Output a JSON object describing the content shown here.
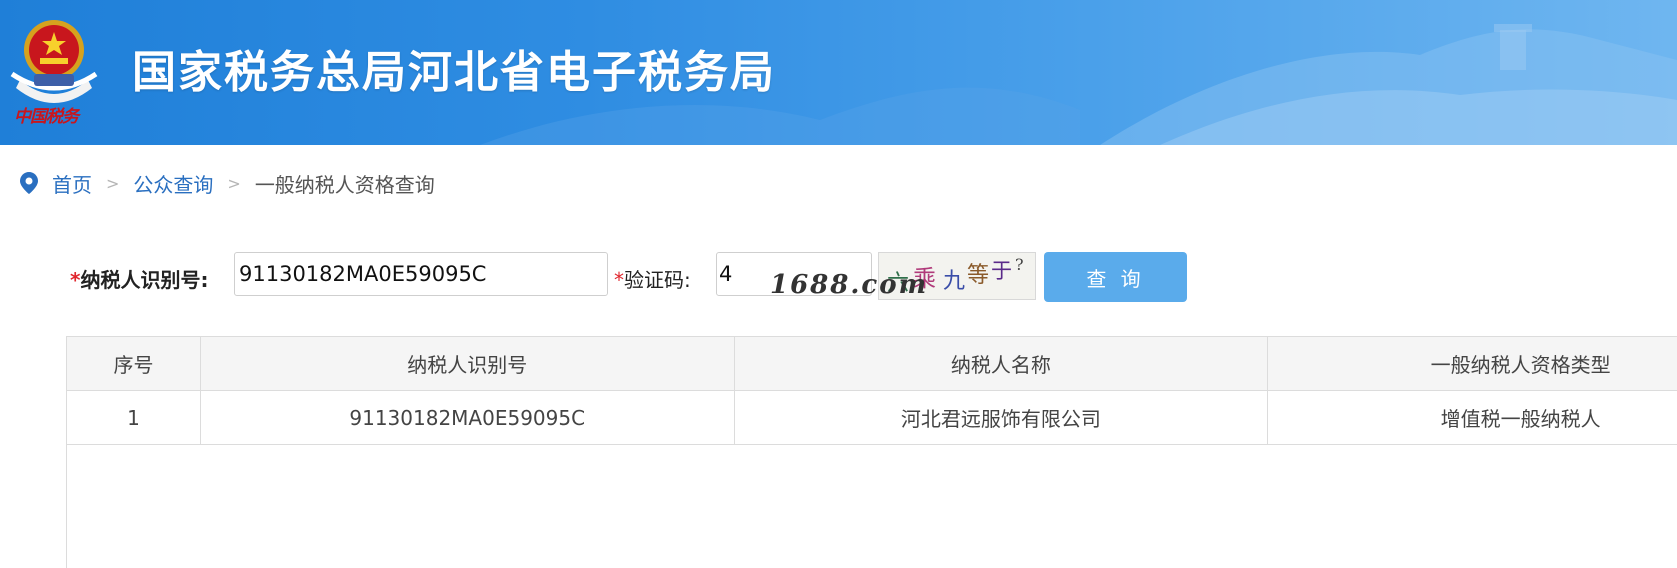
{
  "header": {
    "title": "国家税务总局河北省电子税务局",
    "emblem_caption": "中国税务",
    "colors": {
      "banner_start": "#1f7fd8",
      "banner_end": "#6fb6f0",
      "emblem_red": "#c8161d"
    }
  },
  "breadcrumb": {
    "icon": "location-pin-icon",
    "items": [
      {
        "label": "首页"
      },
      {
        "label": "公众查询"
      },
      {
        "label": "一般纳税人资格查询"
      }
    ],
    "separator": ">"
  },
  "form": {
    "required_mark": "*",
    "taxid_label": "纳税人识别号:",
    "taxid_value": "91130182MA0E59095C",
    "captcha_label": "验证码:",
    "captcha_value": "4",
    "captcha_text": [
      "六",
      "乘",
      "九",
      "等",
      "于",
      "?"
    ],
    "query_button": "查 询",
    "watermark": "1688.com",
    "colors": {
      "button": "#5aabeb",
      "required": "#e0262d"
    }
  },
  "table": {
    "headers": [
      "序号",
      "纳税人识别号",
      "纳税人名称",
      "一般纳税人资格类型"
    ],
    "rows": [
      [
        "1",
        "91130182MA0E59095C",
        "河北君远服饰有限公司",
        "增值税一般纳税人"
      ]
    ]
  }
}
